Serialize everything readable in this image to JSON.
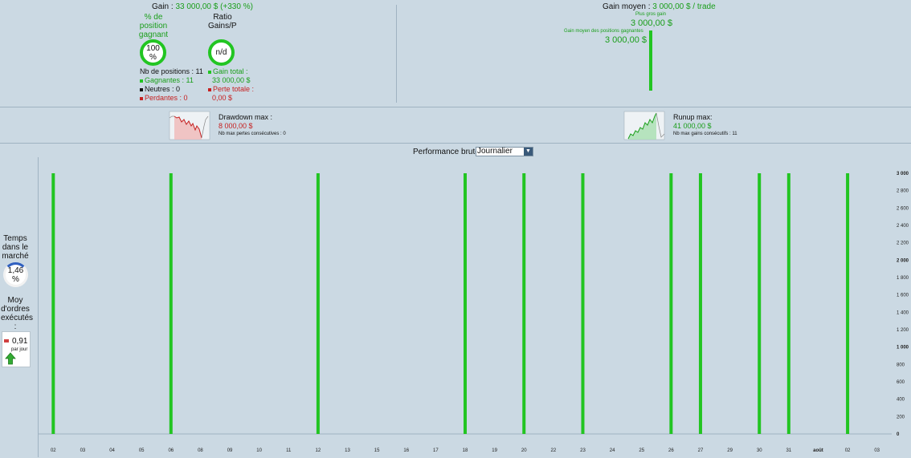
{
  "summary": {
    "gain_label": "Gain :",
    "gain_value": "33 000,00 $ (+330 %)",
    "pct_winning_label_1": "% de",
    "pct_winning_label_2": "position",
    "pct_winning_label_3": "gagnant",
    "pct_winning_value": "100 %",
    "ratio_label_1": "Ratio",
    "ratio_label_2": "Gains/Pe",
    "ratio_value": "n/d",
    "nb_positions": "Nb de positions : 11",
    "winners": "Gagnantes : 11",
    "neutrals": "Neutres : 0",
    "losers": "Perdantes : 0",
    "total_gain_label": "Gain total :",
    "total_gain_value": "33 000,00 $",
    "total_loss_label": "Perte totale :",
    "total_loss_value": "0,00 $"
  },
  "average": {
    "avg_gain_label": "Gain moyen :",
    "avg_gain_value": "3 000,00 $ / trade",
    "biggest_gain_label": "Plus gros gain",
    "biggest_gain_value": "3 000,00 $",
    "avg_winning_label": "Gain moyen des positions gagnantes",
    "avg_winning_value": "3 000,00 $"
  },
  "drawdown": {
    "label": "Drawdown max :",
    "value": "8 000,00 $",
    "sub": "Nb max pertes consécutives : 0"
  },
  "runup": {
    "label": "Runup max:",
    "value": "41 000,00 $",
    "sub": "Nb max gains consécutifs : 11"
  },
  "market_time": {
    "label_1": "Temps",
    "label_2": "dans le",
    "label_3": "marché",
    "value": "1,46 %"
  },
  "orders": {
    "label_1": "Moy",
    "label_2": "d'ordres",
    "label_3": "exécutés",
    "label_4": ":",
    "value": "0,91",
    "per": "par jour"
  },
  "performance": {
    "label": "Performance brute",
    "period_selected": "Journalier"
  },
  "colors": {
    "bar": "#22c522",
    "background": "#cbd9e3",
    "red": "#c62020",
    "green": "#1a9e1a"
  },
  "chart_data": {
    "type": "bar",
    "title": "Performance brute",
    "x_ticks": [
      "02",
      "03",
      "04",
      "05",
      "06",
      "08",
      "09",
      "10",
      "11",
      "12",
      "13",
      "15",
      "16",
      "17",
      "18",
      "19",
      "20",
      "22",
      "23",
      "24",
      "25",
      "26",
      "27",
      "29",
      "30",
      "31",
      "août",
      "02",
      "03"
    ],
    "categories": [
      "02",
      "06",
      "12",
      "18",
      "20",
      "23",
      "26",
      "27",
      "30",
      "31",
      "02"
    ],
    "values": [
      3000,
      3000,
      3000,
      3000,
      3000,
      3000,
      3000,
      3000,
      3000,
      3000,
      3000
    ],
    "y_ticks": [
      "0",
      "200",
      "400",
      "600",
      "800",
      "1 000",
      "1 200",
      "1 400",
      "1 600",
      "1 800",
      "2 000",
      "2 200",
      "2 400",
      "2 600",
      "2 800",
      "3 000"
    ],
    "ylim": [
      0,
      3000
    ],
    "xlabel": "",
    "ylabel": ""
  }
}
